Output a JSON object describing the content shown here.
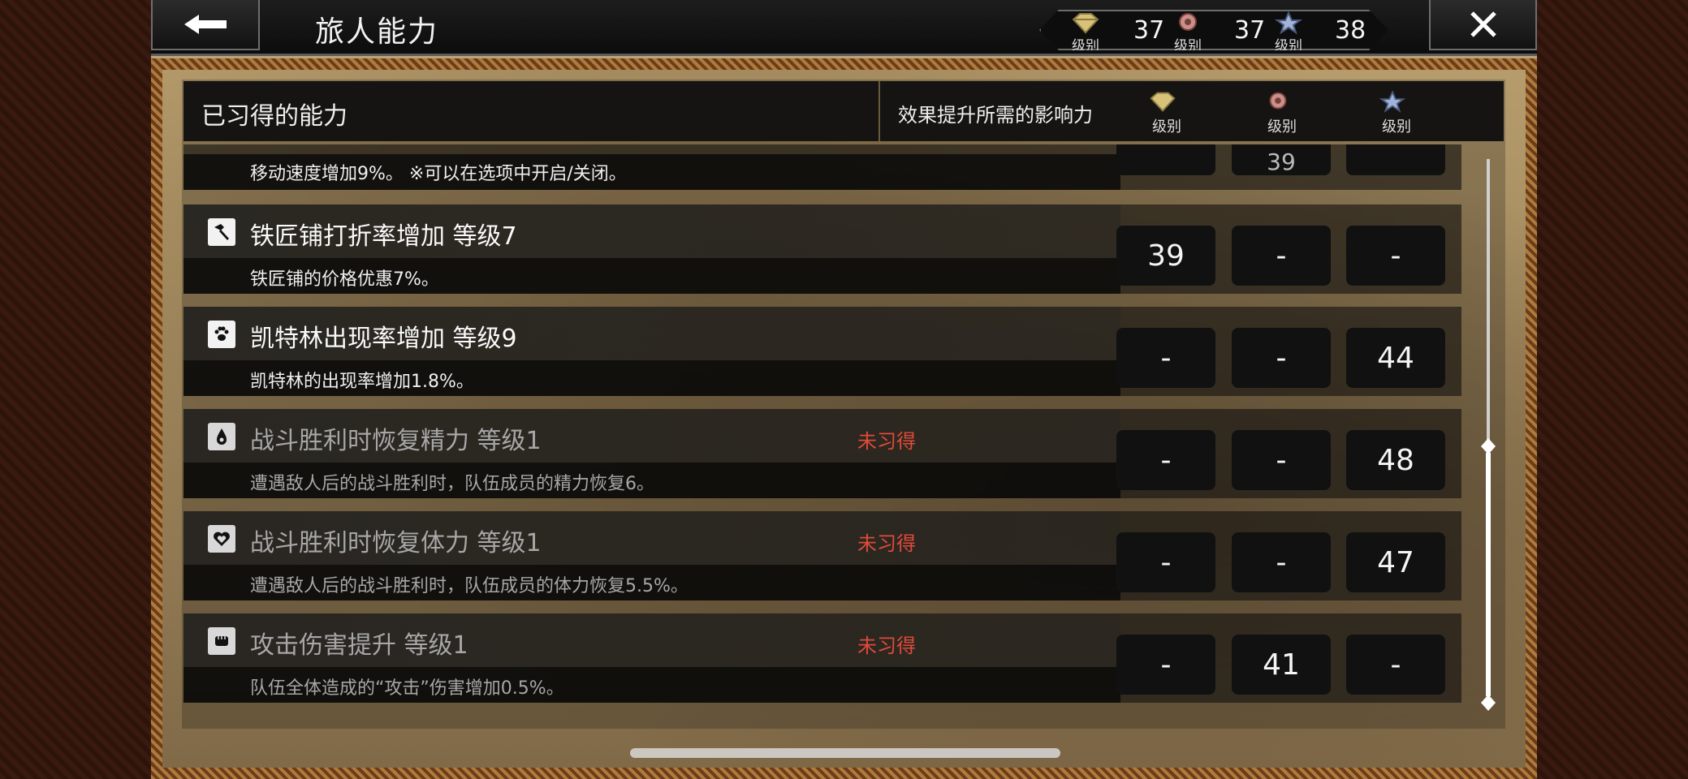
{
  "header": {
    "title": "旅人能力"
  },
  "ranks": [
    {
      "name": "diamond-rank-icon",
      "label": "级别",
      "value": "37"
    },
    {
      "name": "rose-rank-icon",
      "label": "级别",
      "value": "37"
    },
    {
      "name": "star-rank-icon",
      "label": "级别",
      "value": "38"
    }
  ],
  "table_header": {
    "left": "已习得的能力",
    "right": "效果提升所需的影响力",
    "col_labels": [
      "级别",
      "级别",
      "级别"
    ]
  },
  "partial_row": {
    "desc": "移动速度增加9%。 ※可以在选项中开启/关闭。",
    "stub_values": [
      "",
      "39",
      ""
    ]
  },
  "rows": [
    {
      "icon": "hammer-icon",
      "name": "铁匠铺打折率增加  等级7",
      "desc": "铁匠铺的价格优惠7%。",
      "status": "",
      "values": [
        "39",
        "-",
        "-"
      ]
    },
    {
      "icon": "paw-icon",
      "name": "凯特林出现率增加  等级9",
      "desc": "凯特林的出现率增加1.8%。",
      "status": "",
      "values": [
        "-",
        "-",
        "44"
      ]
    },
    {
      "icon": "spiral-drop-icon",
      "name": "战斗胜利时恢复精力  等级1",
      "desc": "遭遇敌人后的战斗胜利时，队伍成员的精力恢复6。",
      "status": "未习得",
      "values": [
        "-",
        "-",
        "48"
      ]
    },
    {
      "icon": "heart-icon",
      "name": "战斗胜利时恢复体力  等级1",
      "desc": "遭遇敌人后的战斗胜利时，队伍成员的体力恢复5.5%。",
      "status": "未习得",
      "values": [
        "-",
        "-",
        "47"
      ]
    },
    {
      "icon": "fist-icon",
      "name": "攻击伤害提升  等级1",
      "desc": "队伍全体造成的“攻击”伤害增加0.5%。",
      "status": "未习得",
      "values": [
        "-",
        "41",
        "-"
      ]
    }
  ],
  "colors": {
    "status_red": "#e04a3a",
    "frame": "#8a5a2a"
  }
}
